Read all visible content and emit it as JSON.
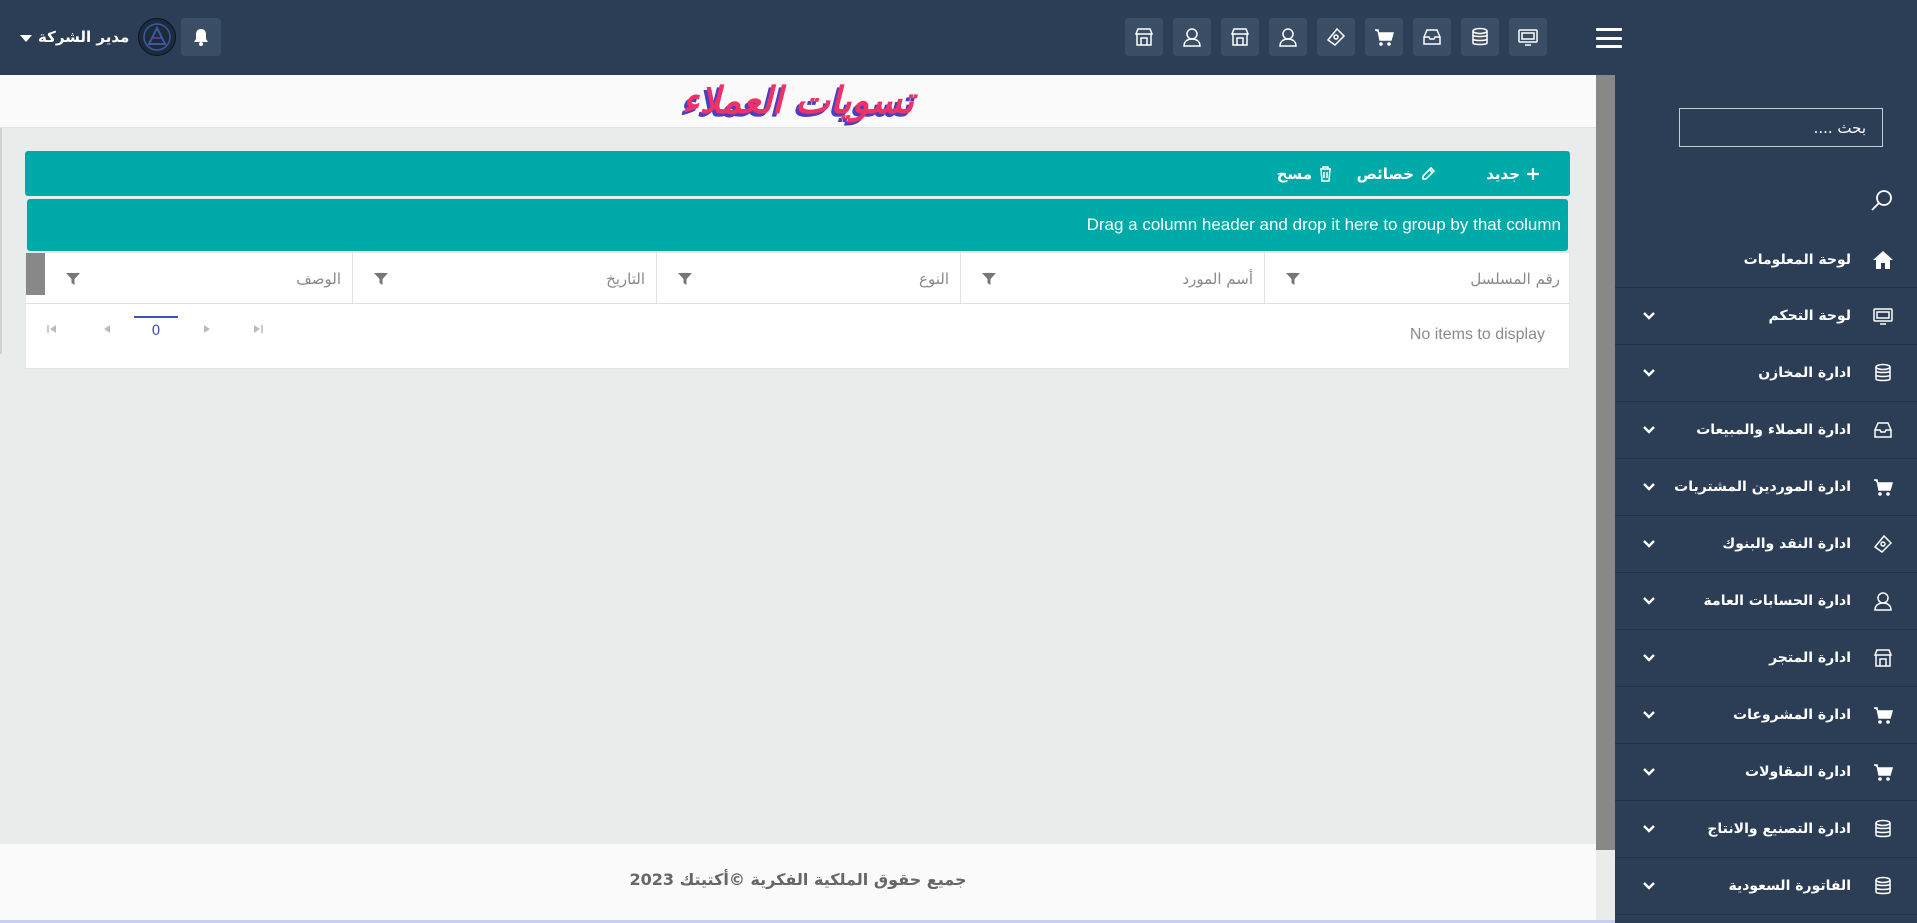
{
  "header": {
    "user_name": "مدير الشركة",
    "quick_icons": [
      "shop-icon",
      "person-icon",
      "shop-icon",
      "person-icon",
      "money-icon",
      "cart-icon",
      "inbox-icon",
      "database-icon",
      "monitor-icon"
    ]
  },
  "sidebar": {
    "search_placeholder": "بحث ....",
    "items": [
      {
        "label": "لوحة المعلومات",
        "icon": "home-icon",
        "has_submenu": false
      },
      {
        "label": "لوحة التحكم",
        "icon": "monitor-icon",
        "has_submenu": true
      },
      {
        "label": "ادارة المخازن",
        "icon": "database-icon",
        "has_submenu": true
      },
      {
        "label": "ادارة العملاء والمبيعات",
        "icon": "inbox-icon",
        "has_submenu": true
      },
      {
        "label": "ادارة الموردين المشتريات",
        "icon": "cart-icon",
        "has_submenu": true
      },
      {
        "label": "ادارة النقد والبنوك",
        "icon": "money-icon",
        "has_submenu": true
      },
      {
        "label": "ادارة الحسابات العامة",
        "icon": "person-icon",
        "has_submenu": true
      },
      {
        "label": "ادارة المتجر",
        "icon": "shop-icon",
        "has_submenu": true
      },
      {
        "label": "ادارة المشروعات",
        "icon": "cart-icon",
        "has_submenu": true
      },
      {
        "label": "ادارة المقاولات",
        "icon": "cart-icon",
        "has_submenu": true
      },
      {
        "label": "ادارة التصنيع والانتاج",
        "icon": "database-icon",
        "has_submenu": true
      },
      {
        "label": "الفاتورة السعودية",
        "icon": "database-icon",
        "has_submenu": true
      }
    ]
  },
  "page": {
    "title": "تسويات العملاء"
  },
  "toolbar": {
    "new_label": "جديد",
    "properties_label": "خصائص",
    "delete_label": "مسح"
  },
  "grid": {
    "group_panel_text": "Drag a column header and drop it here to group by that column",
    "columns": [
      "رقم المسلسل",
      "أسم المورد",
      "النوع",
      "التاريخ",
      "الوصف"
    ],
    "empty_text": "No items to display",
    "current_page": "0"
  },
  "footer": {
    "copyright": "جميع حقوق الملكية الفكرية ©أكتيتك 2023"
  },
  "colors": {
    "sidebar_bg": "#2c3e55",
    "accent_teal": "#00aaa9",
    "title_pink": "#ee3268",
    "title_shadow": "#4a3fc2"
  }
}
